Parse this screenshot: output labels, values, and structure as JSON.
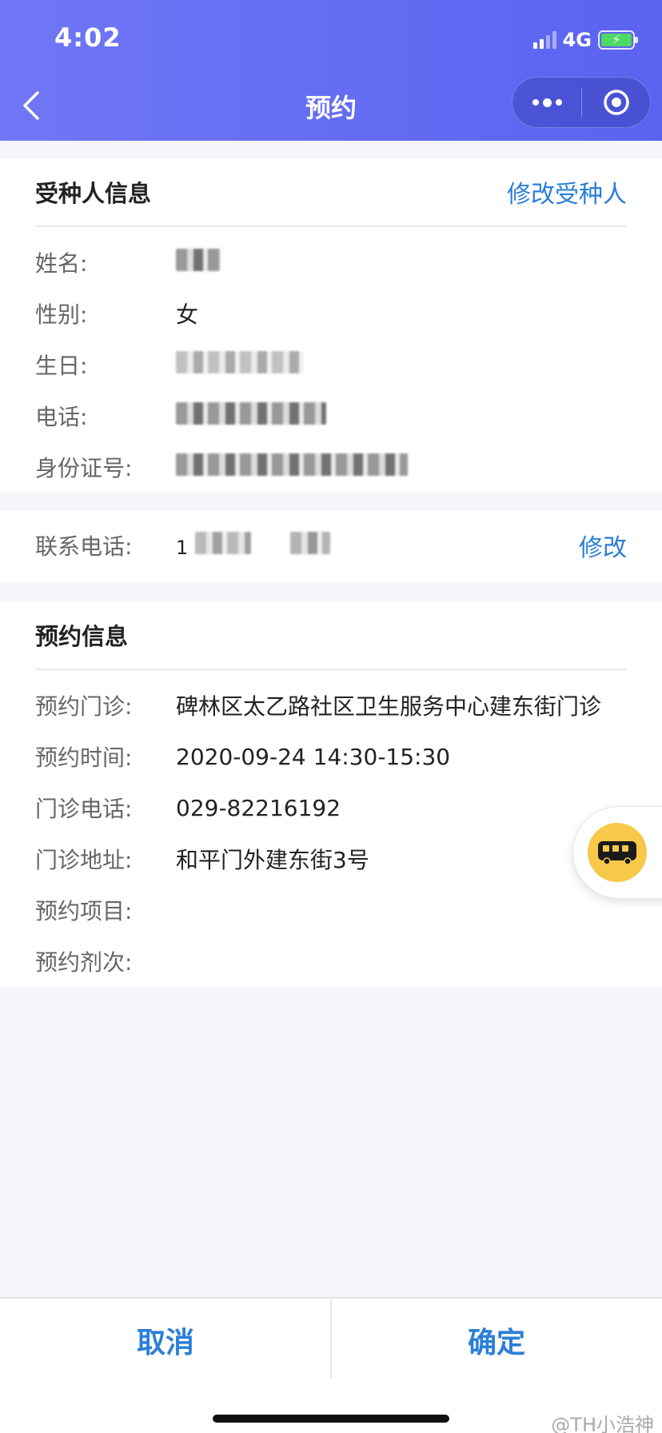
{
  "status_bar": {
    "time": "4:02",
    "network": "4G"
  },
  "nav": {
    "title": "预约"
  },
  "recipient": {
    "title": "受种人信息",
    "edit_label": "修改受种人",
    "fields": [
      {
        "label": "姓名:",
        "value": ""
      },
      {
        "label": "性别:",
        "value": "女"
      },
      {
        "label": "生日:",
        "value": ""
      },
      {
        "label": "电话:",
        "value": ""
      },
      {
        "label": "身份证号:",
        "value": ""
      }
    ]
  },
  "contact": {
    "label": "联系电话:",
    "value_prefix": "1",
    "edit_label": "修改"
  },
  "appointment": {
    "title": "预约信息",
    "fields": [
      {
        "label": "预约门诊:",
        "value": "碑林区太乙路社区卫生服务中心建东街门诊"
      },
      {
        "label": "预约时间:",
        "value": "2020-09-24 14:30-15:30"
      },
      {
        "label": "门诊电话:",
        "value": "029-82216192"
      },
      {
        "label": "门诊地址:",
        "value": "和平门外建东街3号"
      },
      {
        "label": "预约项目:",
        "value": ""
      },
      {
        "label": "预约剂次:",
        "value": ""
      }
    ]
  },
  "footer": {
    "cancel_label": "取消",
    "confirm_label": "确定"
  },
  "watermark": "@TH小浩神",
  "colors": {
    "header": "#5a63f0",
    "accent": "#2a7fd9"
  }
}
